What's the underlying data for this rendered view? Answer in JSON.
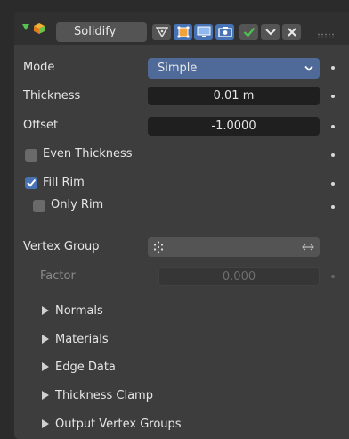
{
  "header": {
    "modifier_name": "Solidify"
  },
  "mode": {
    "label": "Mode",
    "value": "Simple"
  },
  "thickness": {
    "label": "Thickness",
    "value": "0.01 m"
  },
  "offset": {
    "label": "Offset",
    "value": "-1.0000"
  },
  "even_thickness": {
    "label": "Even Thickness",
    "checked": false
  },
  "fill_rim": {
    "label": "Fill Rim",
    "checked": true
  },
  "only_rim": {
    "label": "Only Rim",
    "checked": false
  },
  "vertex_group": {
    "label": "Vertex Group",
    "value": ""
  },
  "factor": {
    "label": "Factor",
    "value": "0.000"
  },
  "subpanels": [
    {
      "label": "Normals"
    },
    {
      "label": "Materials"
    },
    {
      "label": "Edge Data"
    },
    {
      "label": "Thickness Clamp"
    },
    {
      "label": "Output Vertex Groups"
    }
  ],
  "colors": {
    "accent": "#4772b3",
    "check": "#4fbf4f",
    "panel": "#3d3d3d",
    "header": "#303030"
  }
}
